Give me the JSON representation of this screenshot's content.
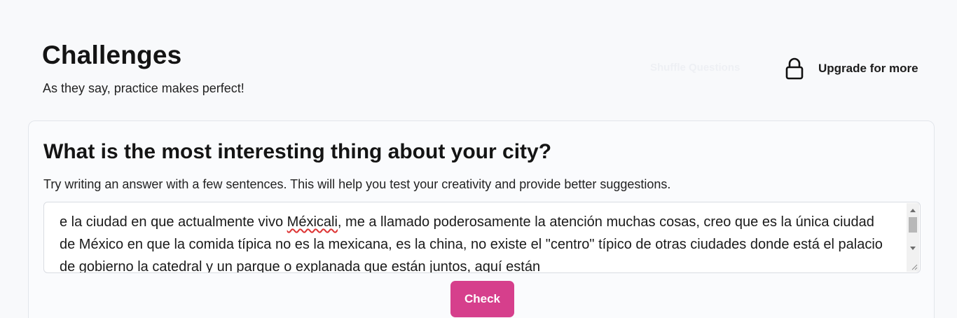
{
  "header": {
    "title": "Challenges",
    "subtitle": "As they say, practice makes perfect!",
    "shuffle_label": "Shuffle Questions",
    "upgrade_label": "Upgrade for more",
    "upgrade_icon": "lock-icon"
  },
  "challenge": {
    "question": "What is the most interesting thing about your city?",
    "hint": "Try writing an answer with a few sentences. This will help you test your creativity and provide better suggestions.",
    "answer_before": "e la ciudad en que actualmente vivo ",
    "answer_misspelled": "Méxicali",
    "answer_after": ", me a llamado poderosamente la atención muchas cosas, creo que es la única ciudad de México en que la comida típica no es la mexicana, es la china, no existe el \"centro\" típico de otras ciudades donde está el palacio de gobierno la catedral y un parque o explanada que están juntos, aquí están",
    "check_label": "Check"
  },
  "colors": {
    "accent": "#d63f8c",
    "background": "#f8f9fb",
    "spellcheck": "#dd3333"
  }
}
